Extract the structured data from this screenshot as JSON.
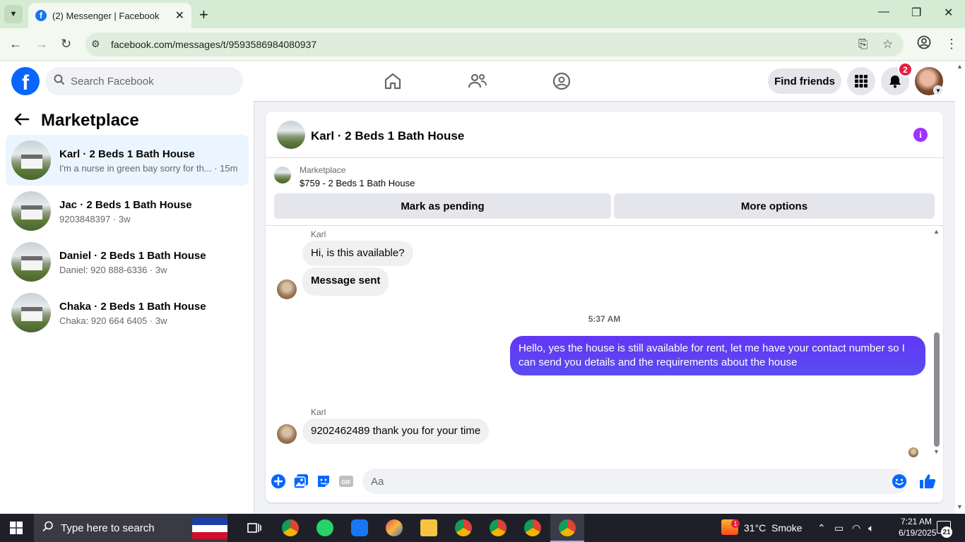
{
  "browser": {
    "tab_title": "(2) Messenger | Facebook",
    "url": "facebook.com/messages/t/9593586984080937"
  },
  "fb_header": {
    "search_placeholder": "Search Facebook",
    "find_friends_label": "Find friends",
    "notification_count": "2"
  },
  "sidebar": {
    "title": "Marketplace",
    "conversations": [
      {
        "name": "Karl · 2 Beds 1 Bath House",
        "preview": "I'm a nurse in green bay sorry for th... · 15m"
      },
      {
        "name": "Jac · 2 Beds 1 Bath House",
        "preview": "9203848397 · 3w"
      },
      {
        "name": "Daniel · 2 Beds 1 Bath House",
        "preview": "Daniel: 920 888-6336 · 3w"
      },
      {
        "name": "Chaka · 2 Beds 1 Bath House",
        "preview": "Chaka: 920 664 6405 · 3w"
      }
    ]
  },
  "chat": {
    "title": "Karl · 2 Beds 1 Bath House",
    "listing_label": "Marketplace",
    "listing_price": "$759 - 2 Beds 1 Bath House",
    "mark_pending_label": "Mark as pending",
    "more_options_label": "More options",
    "messages": [
      {
        "sender": "Karl",
        "text": "Hi, is this available?"
      },
      {
        "text": "Message sent"
      },
      {
        "timestamp": "5:37 AM"
      },
      {
        "text": "Hello, yes the house is still available for rent, let me have your contact number so I can send you details and the requirements about the house"
      },
      {
        "sender": "Karl",
        "text": "9202462489 thank you for your time"
      }
    ],
    "composer_placeholder": "Aa"
  },
  "taskbar": {
    "search_text": "Type here to search",
    "weather_temp": "31°C",
    "weather_desc": "Smoke",
    "time": "7:21 AM",
    "date": "6/19/2025",
    "notification_count": "21",
    "weather_badge": "1"
  },
  "colors": {
    "fb_blue": "#0866ff",
    "outgoing_bubble": "#5b43f2",
    "info_purple": "#a033ff",
    "badge_red": "#e41e3f"
  }
}
